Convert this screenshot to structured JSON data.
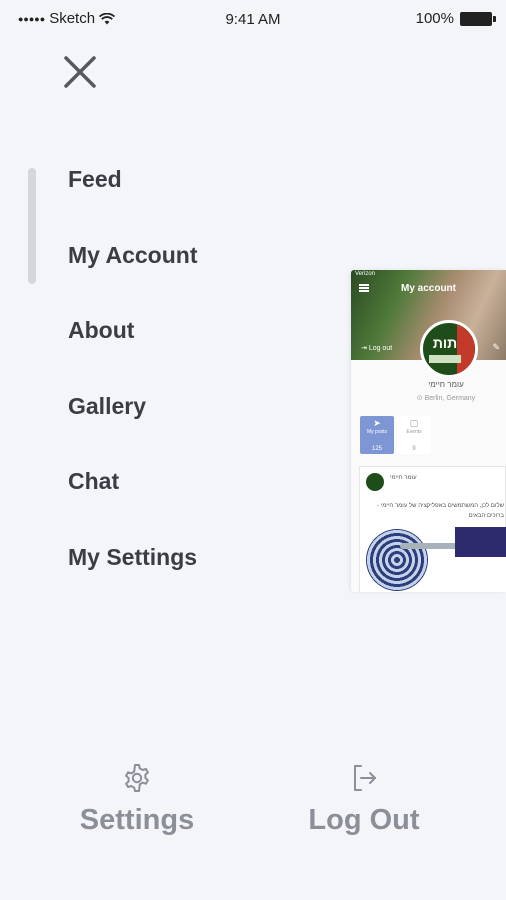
{
  "status_bar": {
    "carrier": "Sketch",
    "time": "9:41 AM",
    "battery": "100%"
  },
  "menu": {
    "items": [
      {
        "label": "Feed"
      },
      {
        "label": "My Account"
      },
      {
        "label": "About"
      },
      {
        "label": "Gallery"
      },
      {
        "label": "Chat"
      },
      {
        "label": "My Settings"
      }
    ]
  },
  "preview": {
    "status_carrier": "Verizon",
    "title": "My account",
    "logout_label": "Log out",
    "avatar_text": "תות",
    "profile_name": "עומר חיימי",
    "profile_location": "Berlin, Germany",
    "tabs": [
      {
        "label": "My posts",
        "count": "125"
      },
      {
        "label": "Events",
        "count": "9"
      }
    ],
    "post": {
      "author": "עומר חיימי",
      "text": "שלום לכן, המשתמשים באפליקציה של עומר חיימי - ברוכים הבאים"
    }
  },
  "bottom": {
    "settings_label": "Settings",
    "logout_label": "Log Out"
  },
  "colors": {
    "background": "#f3f5f9",
    "menu_text": "#3b3d44",
    "bottom_text": "#8b8f98",
    "accent": "#7e97d4"
  }
}
